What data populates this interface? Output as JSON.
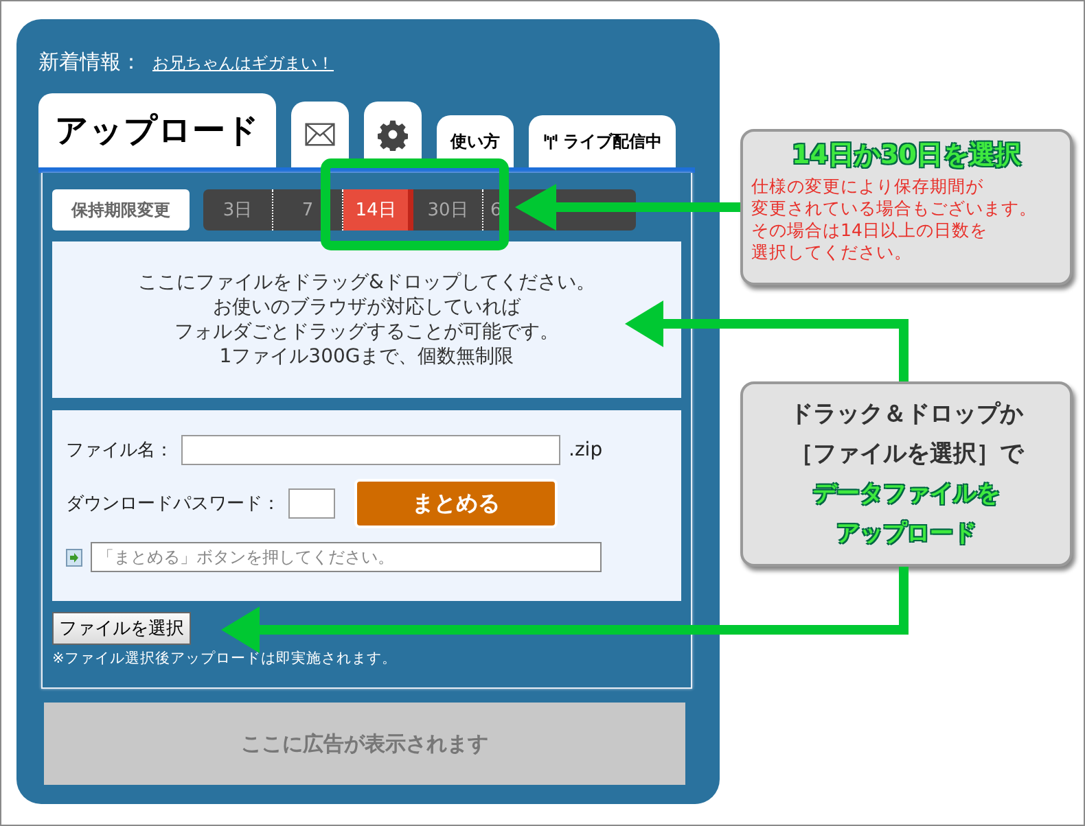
{
  "news": {
    "label": "新着情報：",
    "link": "お兄ちゃんはギガまい！"
  },
  "tabs": [
    {
      "kind": "text",
      "label": "アップロード",
      "selected": true
    },
    {
      "kind": "mail",
      "selected": false
    },
    {
      "kind": "gear",
      "selected": false
    },
    {
      "kind": "text",
      "label": "使い方",
      "selected": false
    },
    {
      "kind": "live",
      "label": "ライブ配信中",
      "selected": false
    }
  ],
  "retention": {
    "button": "保持期限変更",
    "options": [
      {
        "label": "3日",
        "selected": false
      },
      {
        "label": "7",
        "selected": false
      },
      {
        "label": "14日",
        "selected": true
      },
      {
        "label": "30日",
        "selected": false
      },
      {
        "label": "6",
        "selected": false
      }
    ]
  },
  "drop_text": [
    "ここにファイルをドラッグ&ドロップしてください。",
    "お使いのブラウザが対応していれば",
    "フォルダごとドラッグすることが可能です。",
    "1ファイル300Gまで、個数無制限"
  ],
  "form": {
    "filename_label": "ファイル名：",
    "extension": ".zip",
    "password_label": "ダウンロードパスワード：",
    "submit": "まとめる",
    "status_placeholder": "「まとめる」ボタンを押してください。"
  },
  "file_button": "ファイルを選択",
  "note": "※ファイル選択後アップロードは即実施されます。",
  "ad": "ここに広告が表示されます",
  "callouts": [
    {
      "title": "14日か30日を選択",
      "lines": [
        {
          "kind": "warning",
          "text": "仕様の変更により保存期間が"
        },
        {
          "kind": "warning",
          "text": "変更されている場合もございます。"
        },
        {
          "kind": "warning",
          "text": "その場合は14日以上の日数を"
        },
        {
          "kind": "warning",
          "text": "選択してください。"
        }
      ]
    },
    {
      "lines": [
        {
          "kind": "plain",
          "text": "ドラック＆ドロップか"
        },
        {
          "kind": "plain",
          "text": "［ファイルを選択］で"
        },
        {
          "kind": "highlight",
          "text": "データファイルを"
        },
        {
          "kind": "highlight",
          "text": "アップロード"
        }
      ]
    }
  ]
}
